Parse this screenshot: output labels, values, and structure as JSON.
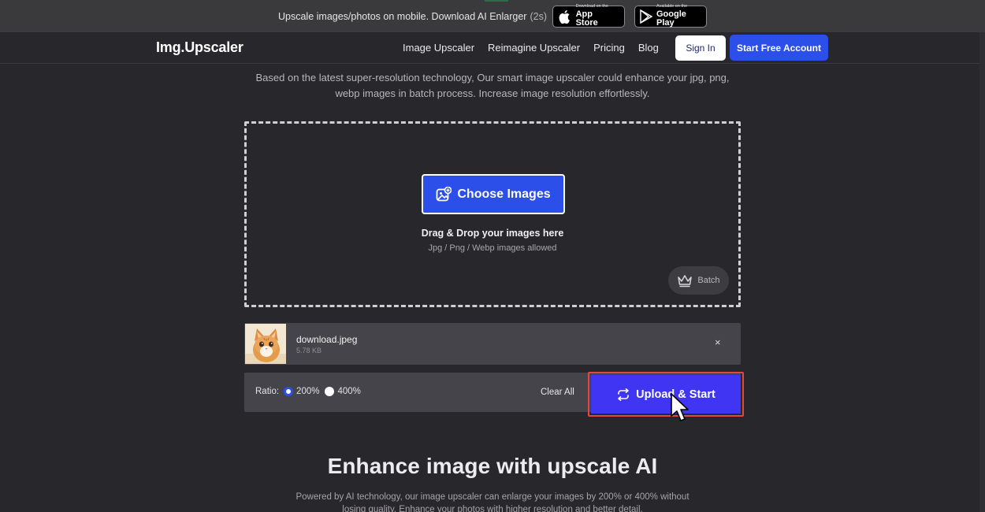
{
  "promo": {
    "text": "Upscale images/photos on mobile. Download AI Enlarger",
    "countdown": "(2s)",
    "app_store": {
      "small": "Download on the",
      "big": "App Store",
      "icon": "apple-icon"
    },
    "google_play": {
      "small": "Available on the",
      "big": "Google Play",
      "icon": "play-icon"
    }
  },
  "nav": {
    "logo": "Img.Upscaler",
    "links": [
      "Image Upscaler",
      "Reimagine Upscaler",
      "Pricing",
      "Blog"
    ],
    "sign_in": "Sign In",
    "start_free": "Start Free Account"
  },
  "intro": "Based on the latest super-resolution technology, Our smart image upscaler could enhance your jpg, png, webp images in batch process. Increase image resolution effortlessly.",
  "dropzone": {
    "choose_label": "Choose Images",
    "title": "Drag & Drop your images here",
    "subtitle": "Jpg / Png / Webp images allowed",
    "batch_label": "Batch"
  },
  "file": {
    "name": "download.jpeg",
    "size": "5.78 KB",
    "close": "×"
  },
  "actions": {
    "ratio_label": "Ratio:",
    "options": [
      "200%",
      "400%"
    ],
    "selected": "200%",
    "clear_all": "Clear All",
    "upload_start": "Upload & Start"
  },
  "section": {
    "title": "Enhance image with upscale AI",
    "text": "Powered by AI technology, our image upscaler can enlarge your images by 200% or 400% without losing quality. Enhance your photos with higher resolution and better detail."
  },
  "colors": {
    "accent": "#2b4fe8",
    "upload": "#3f35f3",
    "highlight": "#e4473f",
    "background": "#28272c"
  }
}
